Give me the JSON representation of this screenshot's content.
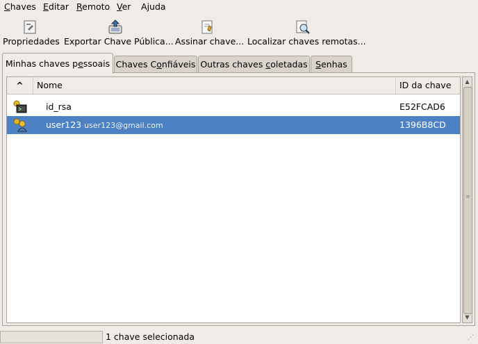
{
  "menubar": {
    "items": [
      {
        "label": "Chaves",
        "mnemonic_index": 0
      },
      {
        "label": "Editar",
        "mnemonic_index": 0
      },
      {
        "label": "Remoto",
        "mnemonic_index": 0
      },
      {
        "label": "Ver",
        "mnemonic_index": 0
      },
      {
        "label": "Ajuda",
        "mnemonic_index": 1
      }
    ]
  },
  "toolbar": {
    "properties_label": "Propriedades",
    "export_label": "Exportar Chave Pública...",
    "sign_label": "Assinar chave...",
    "find_remote_label": "Localizar chaves remotas..."
  },
  "tabs": [
    {
      "label": "Minhas chaves pessoais",
      "active": true
    },
    {
      "label": "Chaves Confiáveis",
      "active": false
    },
    {
      "label": "Outras chaves coletadas",
      "active": false
    },
    {
      "label": "Senhas",
      "active": false
    }
  ],
  "list": {
    "sort_indicator": "^",
    "columns": {
      "name": "Nome",
      "id": "ID da chave"
    },
    "rows": [
      {
        "icon": "ssh-key-icon",
        "name": "id_rsa",
        "email": "",
        "id": "E52FCAD6",
        "selected": false
      },
      {
        "icon": "pgp-key-pair-icon",
        "name": "user123",
        "email": "user123@gmail.com",
        "id": "1396B8CD",
        "selected": true
      }
    ]
  },
  "statusbar": {
    "text": "1 chave selecionada"
  },
  "colors": {
    "selection": "#4c82c3",
    "window_bg": "#efebe7"
  }
}
